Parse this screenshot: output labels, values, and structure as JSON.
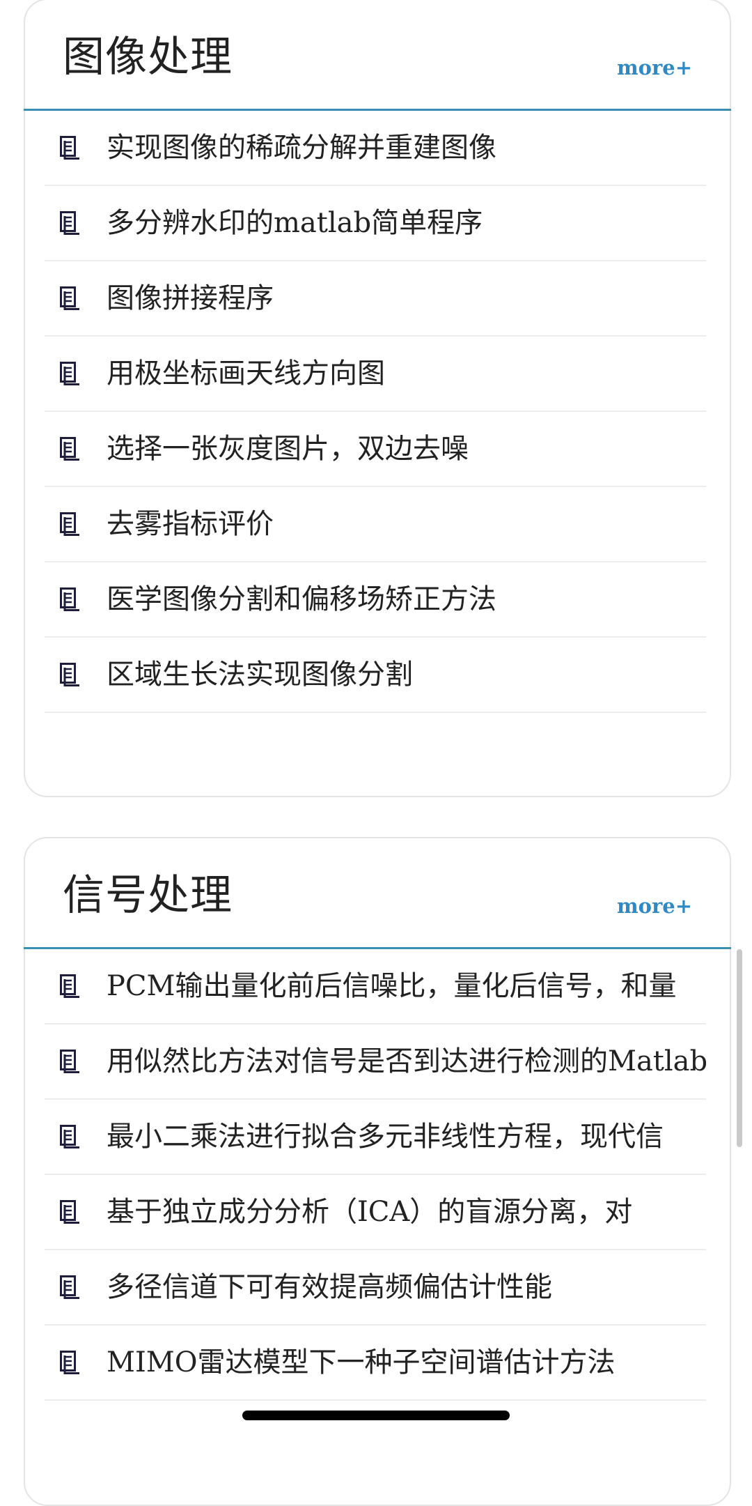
{
  "sections": [
    {
      "title": "图像处理",
      "more_label": "more+",
      "items": [
        "实现图像的稀疏分解并重建图像",
        "多分辨水印的matlab简单程序",
        "图像拼接程序",
        "用极坐标画天线方向图",
        "选择一张灰度图片，双边去噪",
        "去雾指标评价",
        "医学图像分割和偏移场矫正方法",
        "区域生长法实现图像分割"
      ]
    },
    {
      "title": "信号处理",
      "more_label": "more+",
      "items": [
        "PCM输出量化前后信噪比，量化后信号，和量",
        "用似然比方法对信号是否到达进行检测的Matlab",
        "最小二乘法进行拟合多元非线性方程，现代信",
        "基于独立成分分析（ICA）的盲源分离，对",
        "多径信道下可有效提高频偏估计性能",
        "MIMO雷达模型下一种子空间谱估计方法"
      ]
    }
  ],
  "colors": {
    "accent": "#3a8fb5",
    "more_link": "#2e8ac6",
    "icon": "#1e1e3c"
  },
  "icons": {
    "list_item": "document-icon"
  }
}
